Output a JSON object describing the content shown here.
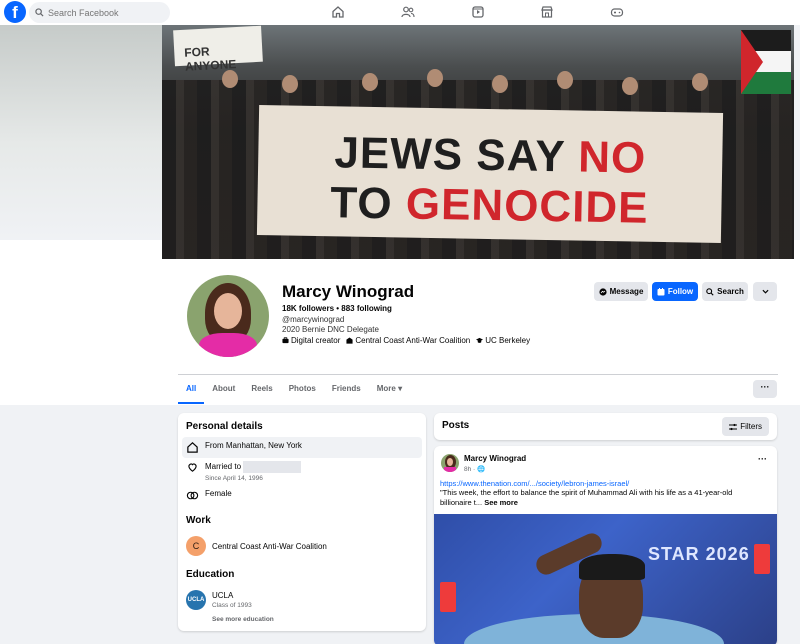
{
  "topbar": {
    "logo": "f",
    "search_placeholder": "Search Facebook",
    "nav_icons": [
      "home-icon",
      "friends-icon",
      "video-icon",
      "marketplace-icon",
      "gaming-icon"
    ]
  },
  "cover": {
    "sign_text": "FOR ANYONE",
    "banner_line1": [
      "JEWS SAY ",
      "NO"
    ],
    "banner_line2": [
      "TO ",
      "GENOCIDE"
    ]
  },
  "profile": {
    "name": "Marcy Winograd",
    "followers": "18K followers • 883 following",
    "handle": "@marcywinograd",
    "bio": "2020 Bernie DNC Delegate",
    "chips": [
      "Digital creator",
      "Central Coast Anti-War Coalition",
      "UC Berkeley"
    ]
  },
  "actions": {
    "message": "Message",
    "follow": "Follow",
    "search": "Search"
  },
  "tabs": [
    "All",
    "About",
    "Reels",
    "Photos",
    "Friends",
    "More"
  ],
  "details": {
    "personal_title": "Personal details",
    "from": "From Manhattan, New York",
    "married": "Married to",
    "married_since": "Since April 14, 1996",
    "gender": "Female",
    "work_title": "Work",
    "work_letter": "C",
    "work": "Central Coast Anti-War Coalition",
    "education_title": "Education",
    "edu_logo": "UCLA",
    "edu_school": "UCLA",
    "edu_class": "Class of 1993",
    "see_more": "See more education"
  },
  "posts": {
    "title": "Posts",
    "filters": "Filters",
    "author": "Marcy Winograd",
    "time": "8h",
    "link": "https://www.thenation.com/.../society/lebron-james-israel/",
    "text": "\"This week, the effort to balance the spirit of Muhammad Ali with his life as a 41-year-old billionaire t...",
    "see_more": "See more",
    "image_text": "STAR 2026"
  },
  "colors": {
    "brand": "#0866ff",
    "page_bg": "#f0f2f5"
  }
}
